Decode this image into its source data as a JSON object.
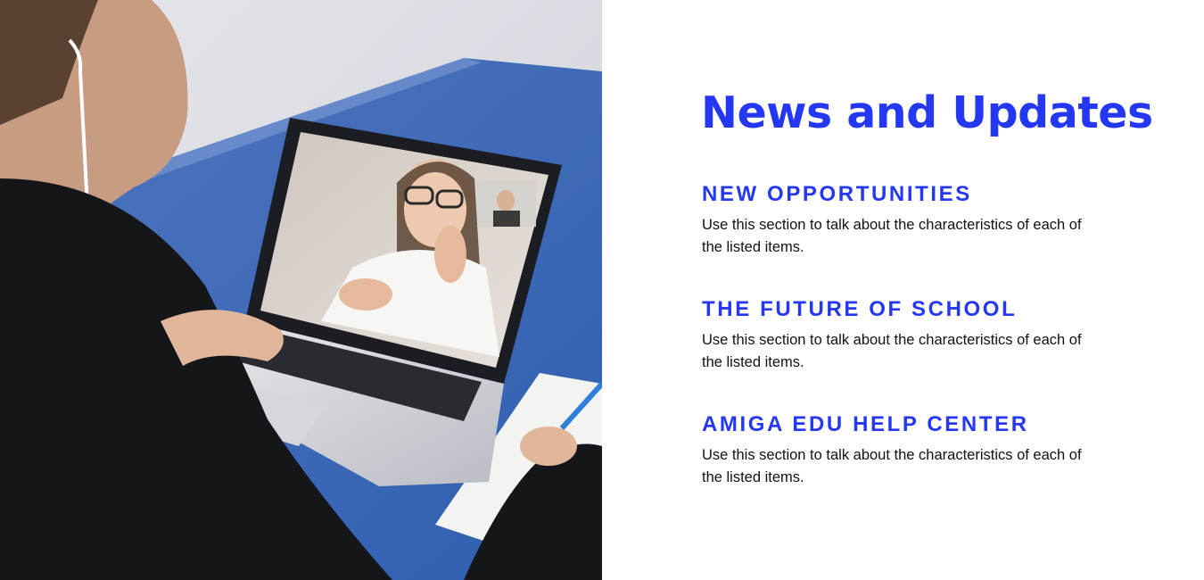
{
  "slide": {
    "title": "News and Updates",
    "accent_color": "#2437f2",
    "photo": {
      "kind": "photo",
      "icon": "video-call-photo"
    },
    "sections": [
      {
        "heading": "NEW OPPORTUNITIES",
        "body": "Use this section to talk about the characteristics of each of the listed items."
      },
      {
        "heading": "THE FUTURE OF SCHOOL",
        "body": "Use this section to talk about the characteristics of each of the listed items."
      },
      {
        "heading": "AMIGA EDU HELP CENTER",
        "body": "Use this section to talk about the characteristics of each of the listed items."
      }
    ]
  }
}
